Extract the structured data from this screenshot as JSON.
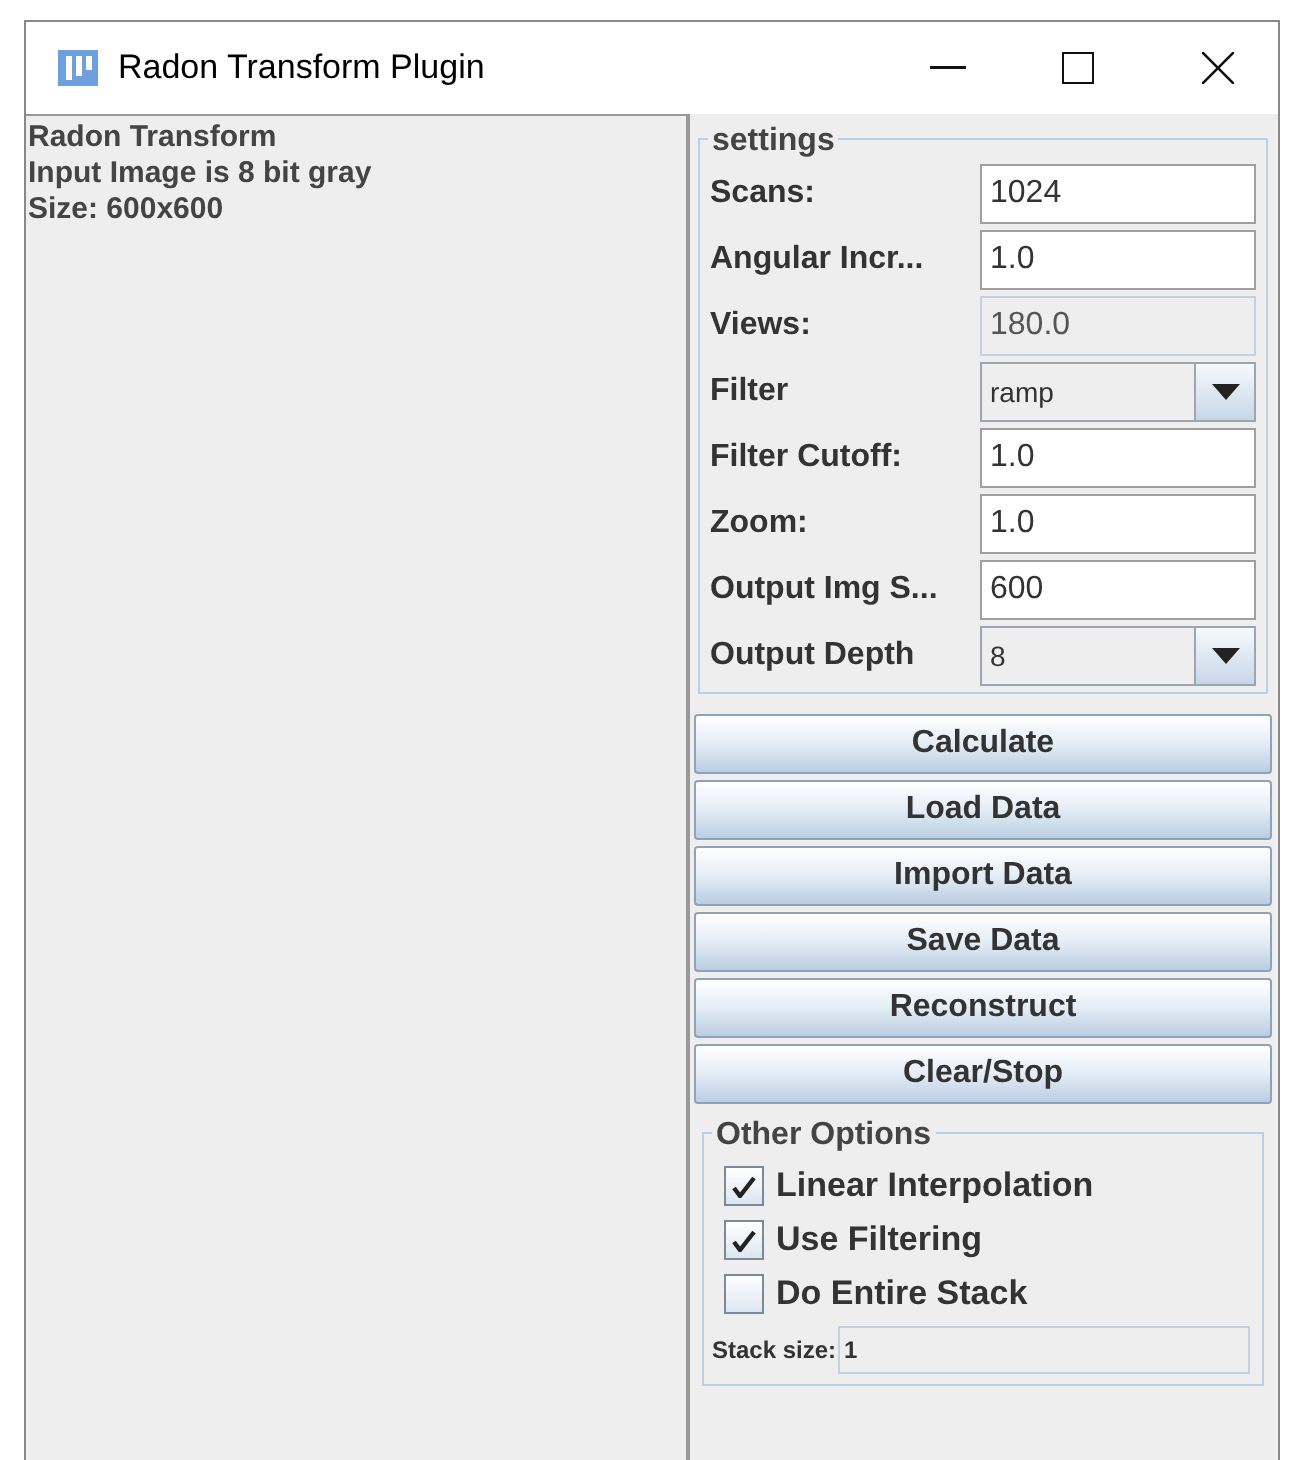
{
  "window": {
    "title": "Radon Transform Plugin"
  },
  "log": [
    "Radon Transform",
    "Input Image is 8 bit gray",
    "Size: 600x600"
  ],
  "settings": {
    "title": "settings",
    "rows": [
      {
        "label": "Scans:",
        "kind": "text",
        "value": "1024"
      },
      {
        "label": "Angular Incr...",
        "kind": "text",
        "value": "1.0"
      },
      {
        "label": "Views:",
        "kind": "readonly",
        "value": "180.0"
      },
      {
        "label": "Filter",
        "kind": "dropdown",
        "value": "ramp"
      },
      {
        "label": "Filter Cutoff:",
        "kind": "text",
        "value": "1.0"
      },
      {
        "label": "Zoom:",
        "kind": "text",
        "value": "1.0"
      },
      {
        "label": "Output Img S...",
        "kind": "text",
        "value": "600"
      },
      {
        "label": "Output Depth",
        "kind": "dropdown",
        "value": "8"
      }
    ]
  },
  "buttons": [
    "Calculate",
    "Load Data",
    "Import Data",
    "Save Data",
    "Reconstruct",
    "Clear/Stop"
  ],
  "other_options": {
    "title": "Other Options",
    "checkboxes": [
      {
        "label": "Linear Interpolation",
        "checked": true
      },
      {
        "label": "Use Filtering",
        "checked": true
      },
      {
        "label": "Do Entire Stack",
        "checked": false
      }
    ],
    "stack_size": {
      "label": "Stack size:",
      "value": "1"
    }
  }
}
